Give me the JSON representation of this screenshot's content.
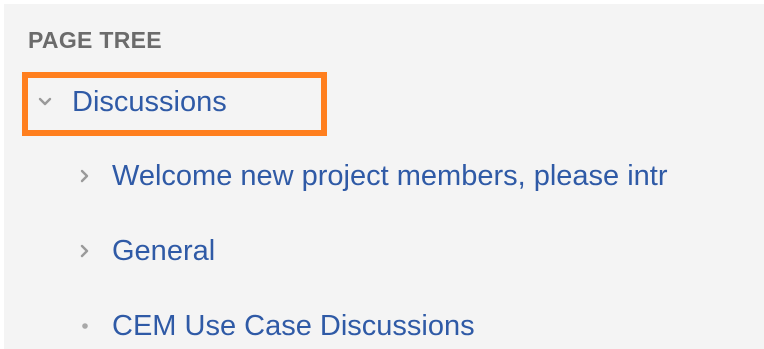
{
  "page_tree": {
    "heading": "PAGE TREE",
    "root": {
      "label": "Discussions",
      "state": "expanded",
      "icon": "chevron-down-icon"
    },
    "children": [
      {
        "label": "Welcome new project members, please intr",
        "icon": "chevron-right-icon"
      },
      {
        "label": "General",
        "icon": "chevron-right-icon"
      },
      {
        "label": "CEM Use Case Discussions",
        "icon": "bullet-icon"
      }
    ]
  },
  "colors": {
    "panel_background": "#f4f4f4",
    "heading_text": "#6b6b6b",
    "link_text": "#2f5aa6",
    "highlight_border": "#ff7f1e",
    "toggle_icon": "#9a9a9a"
  }
}
